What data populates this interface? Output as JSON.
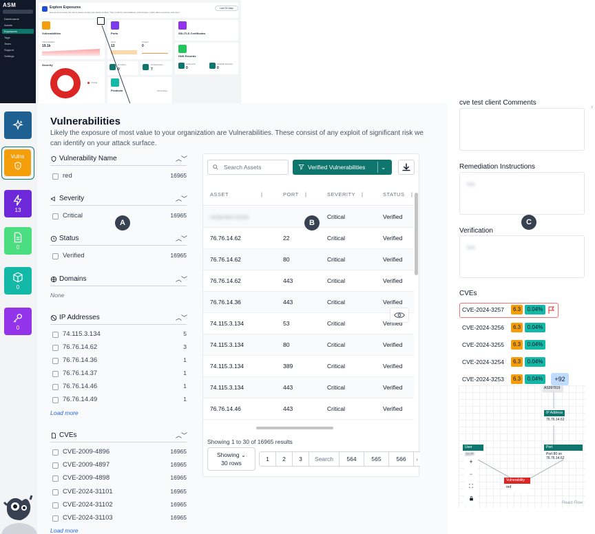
{
  "mini": {
    "logo": "ASM",
    "nav": [
      "Dashboards",
      "Assets",
      "Exposures",
      "Tags",
      "Team",
      "Support",
      "Settings"
    ],
    "header_title": "Explore Exposures",
    "header_desc": "Exposures increase the risk of assets across your attack surface. They could be vulnerabilities, technologies, public data exposures, and more.",
    "header_btn": "Last 30 days",
    "cards": {
      "vulns": {
        "title": "Vulnerabilities",
        "stat_label": "Vulnerabilities",
        "stat": "19.1k"
      },
      "ports": {
        "title": "Ports",
        "open_label": "Open",
        "open": "13",
        "closed_label": "Closed",
        "closed": "0"
      },
      "ssl": {
        "title": "SSL/TLS Certificates"
      },
      "dns": {
        "title": "DNS Records",
        "a_label": "A Records",
        "a": "0",
        "cname_label": "CNAME Records",
        "cname": "0"
      },
      "severity": {
        "title": "Severity",
        "legend": "Critical"
      },
      "domains": {
        "title": "Domains",
        "value": "0"
      },
      "ip": {
        "title": "IP Addresses",
        "value": "7"
      },
      "products": {
        "title": "Products",
        "more": "Show More"
      }
    }
  },
  "rail": {
    "vulns_label": "Vulns",
    "ports_count": "13",
    "docs_count": "0",
    "box_count": "0",
    "key_count": "0"
  },
  "main": {
    "title": "Vulnerabilities",
    "description": "Likely the exposure of most value to your organization are Vulnerabilities. These consist of any exploit of significant risk we can identify on your attack surface.",
    "filters": {
      "vuln_name": {
        "label": "Vulnerability Name",
        "options": [
          {
            "text": "red",
            "count": "16965"
          }
        ]
      },
      "severity": {
        "label": "Severity",
        "options": [
          {
            "text": "Critical",
            "count": "16965"
          }
        ]
      },
      "status": {
        "label": "Status",
        "options": [
          {
            "text": "Verified",
            "count": "16965"
          }
        ]
      },
      "domains": {
        "label": "Domains",
        "none": "None"
      },
      "ip": {
        "label": "IP Addresses",
        "options": [
          {
            "text": "74.115.3.134",
            "count": "5"
          },
          {
            "text": "76.76.14.62",
            "count": "3"
          },
          {
            "text": "76.76.14.36",
            "count": "1"
          },
          {
            "text": "76.76.14.37",
            "count": "1"
          },
          {
            "text": "76.76.14.46",
            "count": "1"
          },
          {
            "text": "76.76.14.49",
            "count": "1"
          }
        ],
        "load_more": "Load more"
      },
      "cves": {
        "label": "CVEs",
        "options": [
          {
            "text": "CVE-2009-4896",
            "count": "16965"
          },
          {
            "text": "CVE-2009-4897",
            "count": "16965"
          },
          {
            "text": "CVE-2009-4898",
            "count": "16965"
          },
          {
            "text": "CVE-2024-31101",
            "count": "16965"
          },
          {
            "text": "CVE-2024-31102",
            "count": "16965"
          },
          {
            "text": "CVE-2024-31103",
            "count": "16965"
          }
        ],
        "load_more": "Load more"
      }
    },
    "markers": {
      "a": "A",
      "b": "B",
      "c": "C"
    },
    "toolbar": {
      "search_placeholder": "Search Assets",
      "verified_label": "Verified Vulnerabilities"
    },
    "table": {
      "headers": [
        "ASSET",
        "PORT",
        "SEVERITY",
        "STATUS"
      ],
      "rows": [
        {
          "asset": "redacted-asset",
          "port": "",
          "severity": "Critical",
          "status": "Verified"
        },
        {
          "asset": "76.76.14.62",
          "port": "22",
          "severity": "Critical",
          "status": "Verified"
        },
        {
          "asset": "76.76.14.62",
          "port": "80",
          "severity": "Critical",
          "status": "Verified"
        },
        {
          "asset": "76.76.14.62",
          "port": "443",
          "severity": "Critical",
          "status": "Verified"
        },
        {
          "asset": "76.76.14.36",
          "port": "443",
          "severity": "Critical",
          "status": "Verified"
        },
        {
          "asset": "74.115.3.134",
          "port": "53",
          "severity": "Critical",
          "status": "Verified"
        },
        {
          "asset": "74.115.3.134",
          "port": "80",
          "severity": "Critical",
          "status": "Verified"
        },
        {
          "asset": "74.115.3.134",
          "port": "389",
          "severity": "Critical",
          "status": "Verified"
        },
        {
          "asset": "74.115.3.134",
          "port": "443",
          "severity": "Critical",
          "status": "Verified"
        },
        {
          "asset": "76.76.14.46",
          "port": "443",
          "severity": "Critical",
          "status": "Verified"
        }
      ]
    },
    "results_text": "Showing 1 to 30 of 16965 results",
    "showing_label": "Showing",
    "showing_value": "30 rows",
    "pagination": [
      "1",
      "2",
      "3",
      "Search",
      "564",
      "565",
      "566",
      "›"
    ]
  },
  "right": {
    "comments_label": "cve test client Comments",
    "remediation_label": "Remediation Instructions",
    "remediation_text": "N/A",
    "verification_label": "Verification",
    "verification_text": "N/A",
    "cves_label": "CVEs",
    "cves": [
      {
        "id": "CVE-2024-3257",
        "score": "6.3",
        "pct": "0.04%"
      },
      {
        "id": "CVE-2024-3256",
        "score": "6.3",
        "pct": "0.04%"
      },
      {
        "id": "CVE-2024-3255",
        "score": "6.3",
        "pct": "0.04%"
      },
      {
        "id": "CVE-2024-3254",
        "score": "6.3",
        "pct": "0.04%"
      },
      {
        "id": "CVE-2024-3253",
        "score": "6.3",
        "pct": "0.04%"
      }
    ],
    "more_badge": "+92",
    "flow": {
      "asn": "AS397819",
      "ip_head": "IP Address",
      "ip_body": "76.76.14.62",
      "user_head": "User",
      "user_body": "Jacob Rolls",
      "port_head": "Port",
      "port_body": "Port 80 on 76.76.14.62",
      "vuln_head": "Vulnerability",
      "vuln_body": "red",
      "credit": "React Flow"
    }
  },
  "colors": {
    "teal": "#0f766e",
    "amber": "#f59e0b",
    "purple": "#7c3aed",
    "green": "#22c55e",
    "cyan": "#14b8a6",
    "magenta": "#9333ea",
    "red": "#dc2626",
    "navy": "#1e6091"
  },
  "icons": [
    "sparkle-icon",
    "shield-icon",
    "bolt-icon",
    "document-icon",
    "cube-icon",
    "key-icon",
    "search-icon",
    "filter-icon",
    "download-icon",
    "eye-icon",
    "flag-icon",
    "chevron-down-icon"
  ]
}
